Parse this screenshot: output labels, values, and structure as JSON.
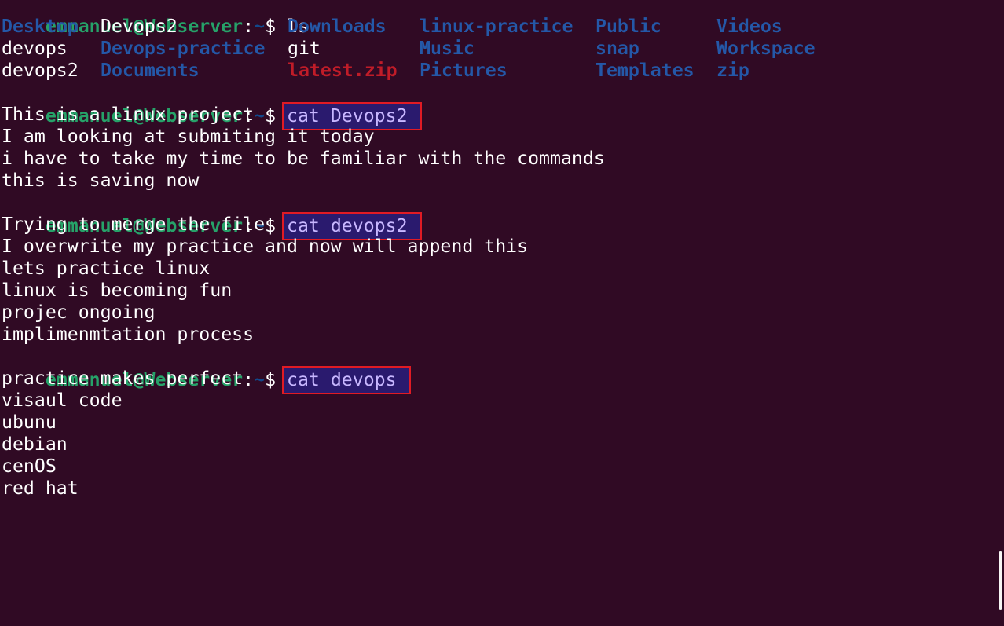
{
  "prompt": {
    "user_host": "emmanuel@Webserver",
    "path": "~",
    "symbol": "$"
  },
  "commands": [
    "ls",
    "cat Devops2",
    "cat devops2",
    "cat devops"
  ],
  "ls_output": {
    "rows": [
      [
        {
          "name": "Desktop",
          "type": "dir"
        },
        {
          "name": "Devops2",
          "type": "file"
        },
        {
          "name": "Downloads",
          "type": "dir"
        },
        {
          "name": "linux-practice",
          "type": "dir"
        },
        {
          "name": "Public",
          "type": "dir"
        },
        {
          "name": "Videos",
          "type": "dir"
        }
      ],
      [
        {
          "name": "devops",
          "type": "file"
        },
        {
          "name": "Devops-practice",
          "type": "dir"
        },
        {
          "name": "git",
          "type": "file"
        },
        {
          "name": "Music",
          "type": "dir"
        },
        {
          "name": "snap",
          "type": "dir"
        },
        {
          "name": "Workspace",
          "type": "dir"
        }
      ],
      [
        {
          "name": "devops2",
          "type": "file"
        },
        {
          "name": "Documents",
          "type": "dir"
        },
        {
          "name": "latest.zip",
          "type": "archive"
        },
        {
          "name": "Pictures",
          "type": "dir"
        },
        {
          "name": "Templates",
          "type": "dir"
        },
        {
          "name": "zip",
          "type": "dir"
        }
      ]
    ]
  },
  "outputs": {
    "Devops2": [
      "This is a linux project",
      "I am looking at submiting it today",
      "i have to take my time to be familiar with the commands",
      "this is saving now"
    ],
    "devops2": [
      "Trying to merge the file",
      "I overwrite my practice and now will append this",
      "lets practice linux",
      "linux is becoming fun",
      "projec ongoing",
      "implimenmtation process"
    ],
    "devops": [
      "practice makes perfect",
      "visaul code",
      "ubunu",
      "debian",
      "cenOS",
      "red hat"
    ]
  },
  "colors": {
    "background": "#300a24",
    "prompt_user": "#26a269",
    "prompt_path": "#12488b",
    "directory": "#2458a8",
    "archive": "#c01c28",
    "highlight_box": "#e01b24"
  }
}
